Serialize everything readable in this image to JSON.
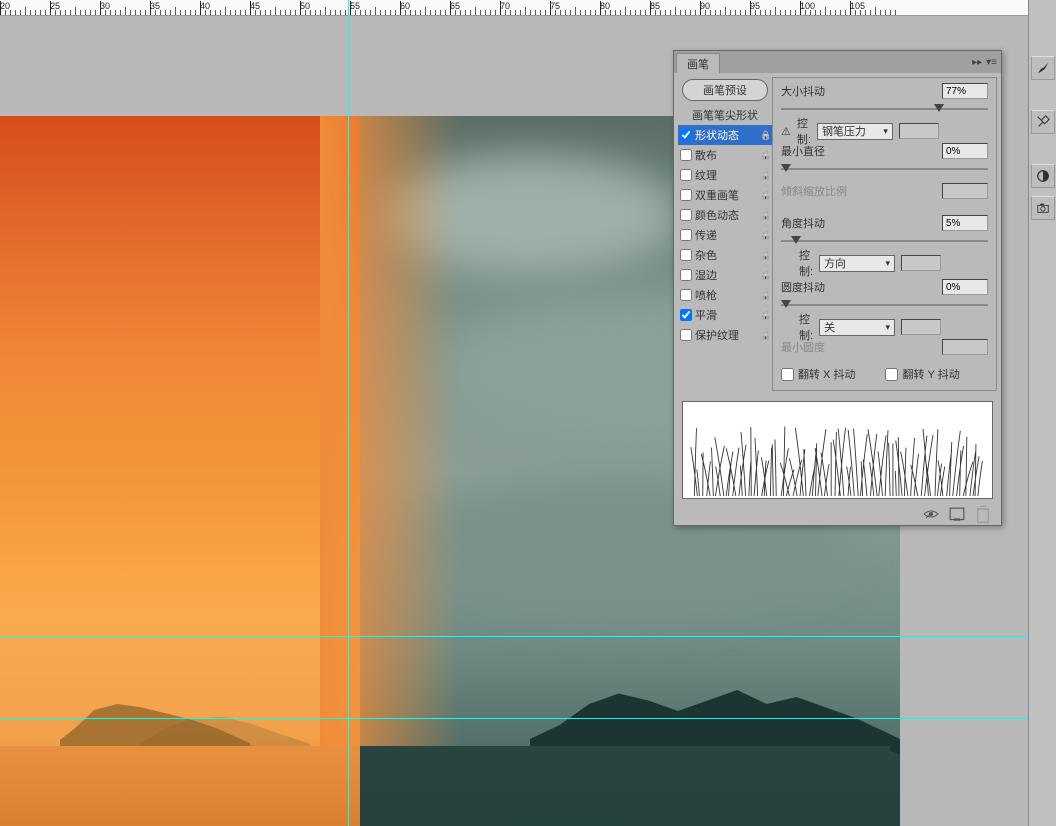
{
  "ruler": {
    "start": 20,
    "step": 5,
    "count": 18
  },
  "panel": {
    "tab": "画笔",
    "preset_button": "画笔预设",
    "options_header": "画笔笔尖形状",
    "options": [
      {
        "label": "形状动态",
        "checked": true,
        "selected": true,
        "locked": true
      },
      {
        "label": "散布",
        "checked": false,
        "locked": true
      },
      {
        "label": "纹理",
        "checked": false,
        "locked": true
      },
      {
        "label": "双重画笔",
        "checked": false,
        "locked": true
      },
      {
        "label": "颜色动态",
        "checked": false,
        "locked": true
      },
      {
        "label": "传递",
        "checked": false,
        "locked": true
      },
      {
        "label": "杂色",
        "checked": false,
        "locked": true
      },
      {
        "label": "湿边",
        "checked": false,
        "locked": true
      },
      {
        "label": "喷枪",
        "checked": false,
        "locked": true
      },
      {
        "label": "平滑",
        "checked": true,
        "locked": true
      },
      {
        "label": "保护纹理",
        "checked": false,
        "locked": true
      }
    ],
    "settings": {
      "size_jitter_label": "大小抖动",
      "size_jitter_value": "77%",
      "control1_label": "控制:",
      "control1_value": "钢笔压力",
      "min_diameter_label": "最小直径",
      "min_diameter_value": "0%",
      "tilt_scale_label": "倾斜缩放比例",
      "angle_jitter_label": "角度抖动",
      "angle_jitter_value": "5%",
      "control2_label": "控制:",
      "control2_value": "方向",
      "roundness_jitter_label": "圆度抖动",
      "roundness_jitter_value": "0%",
      "control3_label": "控制:",
      "control3_value": "关",
      "min_roundness_label": "最小圆度",
      "flip_x_label": "翻转 X 抖动",
      "flip_y_label": "翻转 Y 抖动"
    }
  }
}
